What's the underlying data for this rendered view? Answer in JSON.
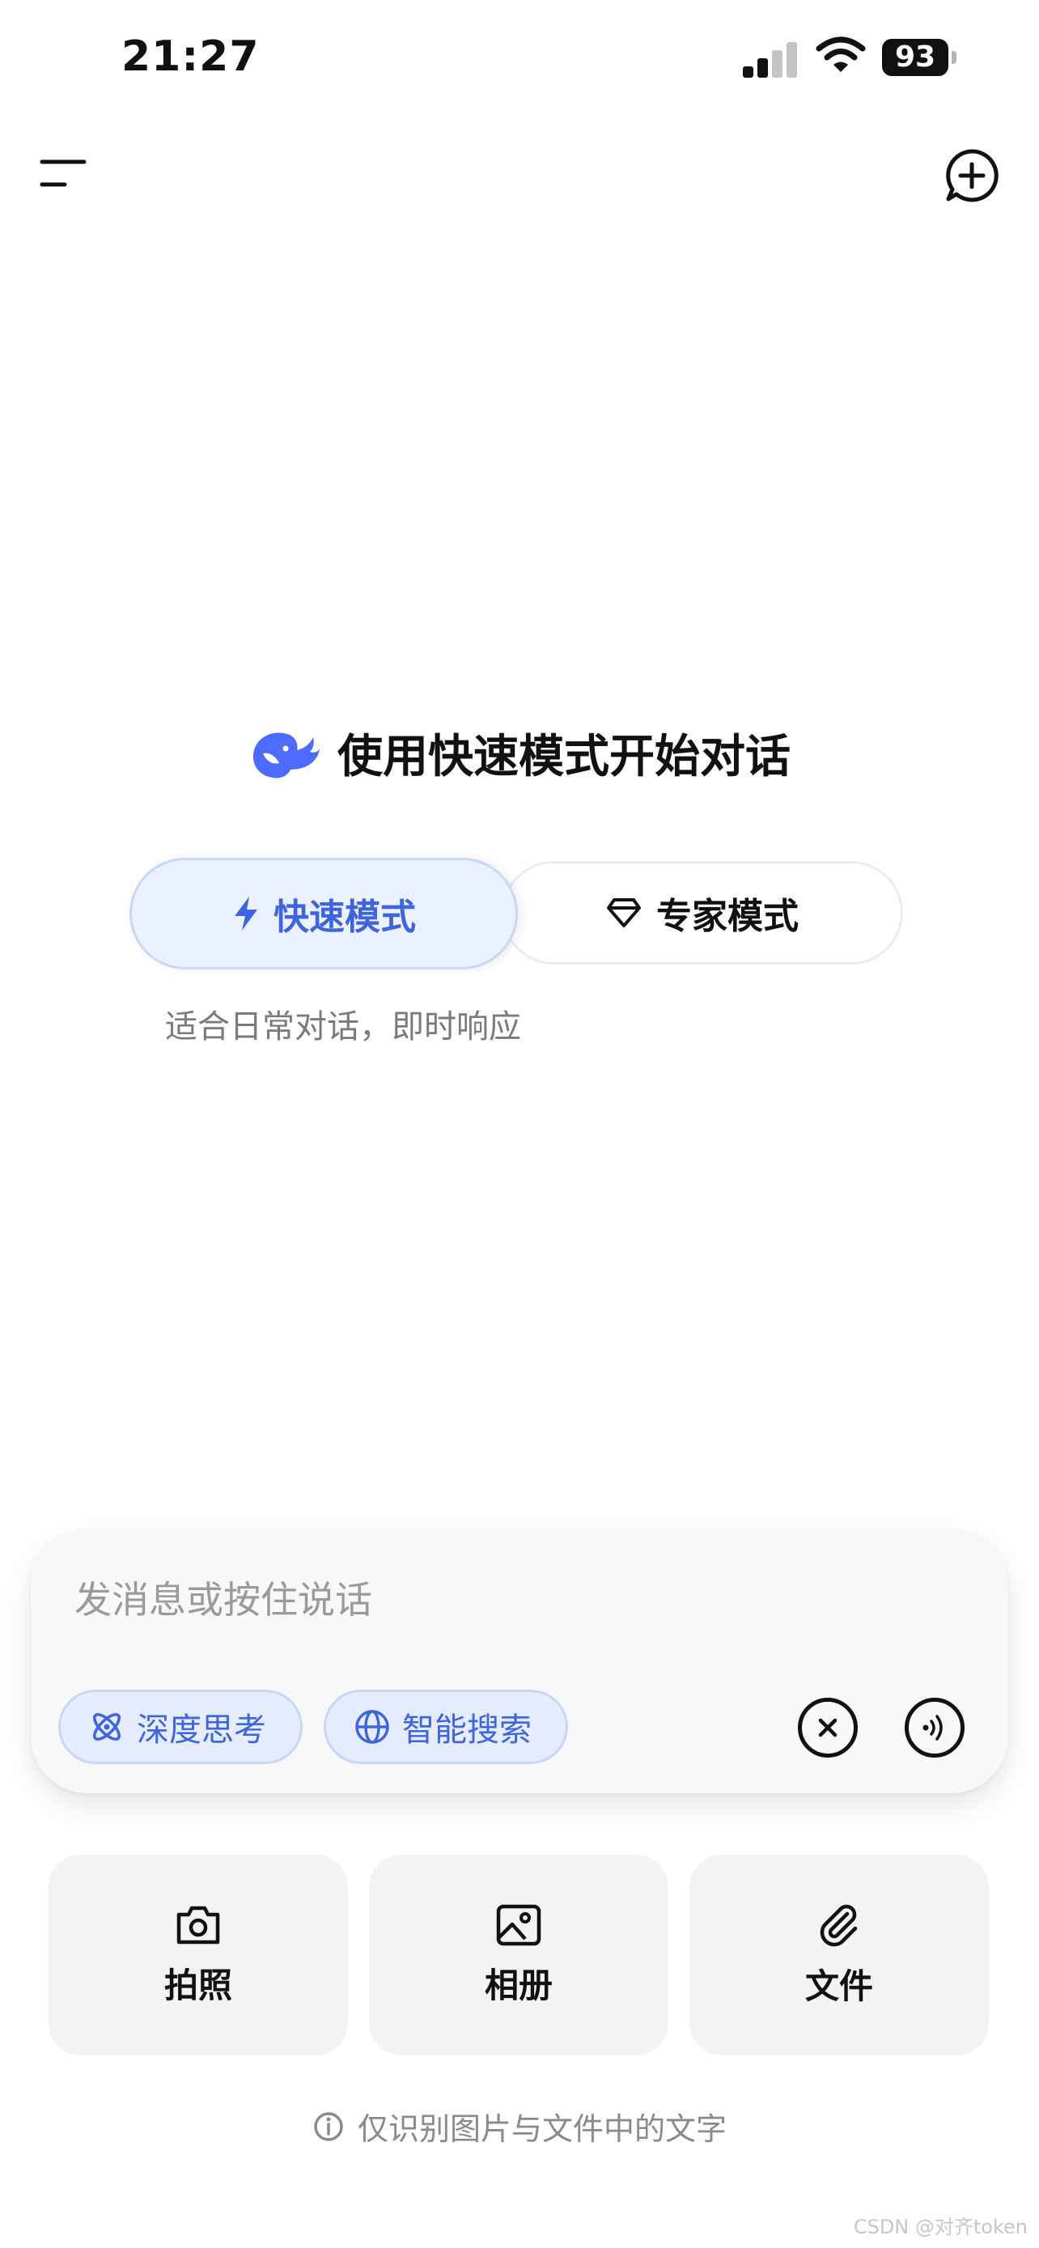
{
  "status_bar": {
    "time": "21:27",
    "battery": "93"
  },
  "greeting": {
    "title": "使用快速模式开始对话"
  },
  "mode_toggle": {
    "fast_label": "快速模式",
    "expert_label": "专家模式",
    "description": "适合日常对话，即时响应"
  },
  "input": {
    "placeholder": "发消息或按住说话",
    "chips": {
      "deep_think": "深度思考",
      "smart_search": "智能搜索"
    }
  },
  "actions": {
    "camera": "拍照",
    "album": "相册",
    "file": "文件"
  },
  "note": "仅识别图片与文件中的文字",
  "watermark": "CSDN @对齐token",
  "colors": {
    "accent": "#3f64e0",
    "chip_bg": "#e4ecfd",
    "card_bg": "#f8f8f8"
  }
}
